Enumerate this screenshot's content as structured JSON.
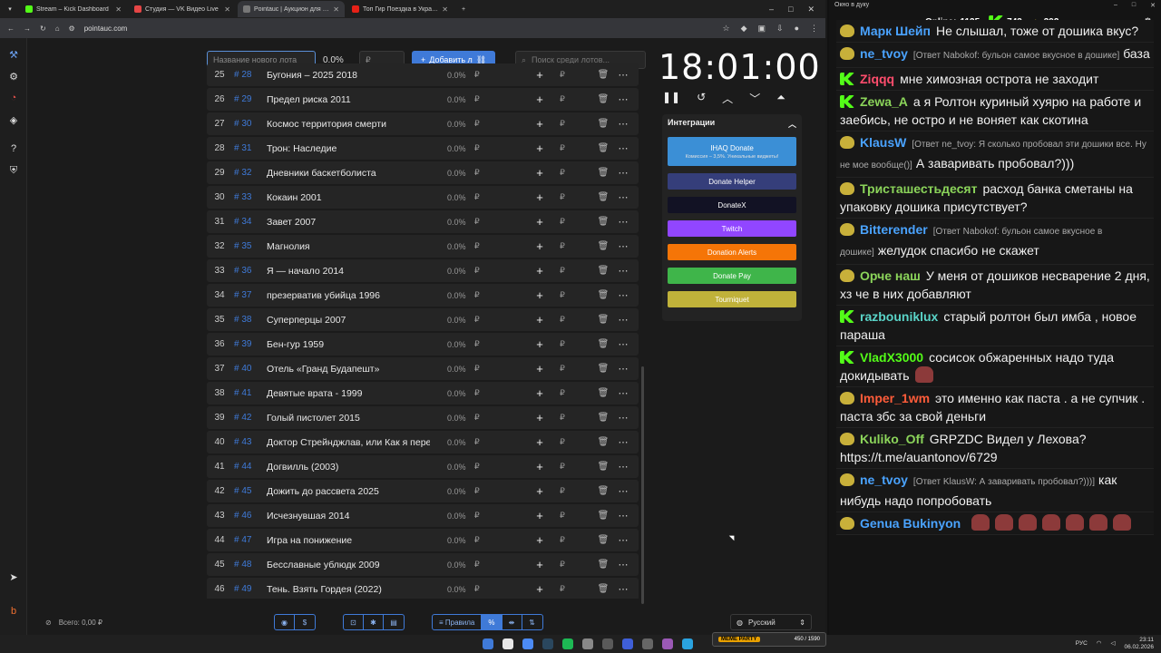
{
  "browser": {
    "tabs": [
      {
        "label": "Stream – Kick Dashboard",
        "color": "#53fc18",
        "active": false
      },
      {
        "label": "Студия — VK Видео Live",
        "color": "#e64646",
        "active": false
      },
      {
        "label": "Pointauc | Аукцион для стримо...",
        "color": "#777777",
        "active": true
      },
      {
        "label": "Топ Гир Поездка в Украину (...",
        "color": "#e62117",
        "active": false
      }
    ],
    "url": "pointauc.com"
  },
  "controls": {
    "new_lot_placeholder": "Название нового лота",
    "percent": "0.0%",
    "amount_placeholder": "₽",
    "add_label": "Добавить л",
    "search_placeholder": "Поиск среди лотов..."
  },
  "lots": [
    {
      "n": "25",
      "id": "# 28",
      "name": "Бугония – 2025 2018",
      "pct": "0.0%"
    },
    {
      "n": "26",
      "id": "# 29",
      "name": "Предел риска 2011",
      "pct": "0.0%"
    },
    {
      "n": "27",
      "id": "# 30",
      "name": "Космос территория смерти",
      "pct": "0.0%"
    },
    {
      "n": "28",
      "id": "# 31",
      "name": "Трон: Наследие",
      "pct": "0.0%"
    },
    {
      "n": "29",
      "id": "# 32",
      "name": "Дневники баскетболиста",
      "pct": "0.0%"
    },
    {
      "n": "30",
      "id": "# 33",
      "name": "Кокаин 2001",
      "pct": "0.0%"
    },
    {
      "n": "31",
      "id": "# 34",
      "name": "Завет 2007",
      "pct": "0.0%"
    },
    {
      "n": "32",
      "id": "# 35",
      "name": "Магнолия",
      "pct": "0.0%"
    },
    {
      "n": "33",
      "id": "# 36",
      "name": "Я — начало 2014",
      "pct": "0.0%"
    },
    {
      "n": "34",
      "id": "# 37",
      "name": "презерватив убийца 1996",
      "pct": "0.0%"
    },
    {
      "n": "35",
      "id": "# 38",
      "name": "Суперперцы 2007",
      "pct": "0.0%"
    },
    {
      "n": "36",
      "id": "# 39",
      "name": "Бен-гур 1959",
      "pct": "0.0%"
    },
    {
      "n": "37",
      "id": "# 40",
      "name": "Отель «Гранд Будапешт»",
      "pct": "0.0%"
    },
    {
      "n": "38",
      "id": "# 41",
      "name": "Девятые врата - 1999",
      "pct": "0.0%"
    },
    {
      "n": "39",
      "id": "# 42",
      "name": "Голый пистолет 2015",
      "pct": "0.0%"
    },
    {
      "n": "40",
      "id": "# 43",
      "name": "Доктор Стрейнджлав, или Как я перес",
      "pct": "0.0%"
    },
    {
      "n": "41",
      "id": "# 44",
      "name": "Догвилль (2003)",
      "pct": "0.0%"
    },
    {
      "n": "42",
      "id": "# 45",
      "name": "Дожить до рассвета 2025",
      "pct": "0.0%"
    },
    {
      "n": "43",
      "id": "# 46",
      "name": "Исчезнувшая 2014",
      "pct": "0.0%"
    },
    {
      "n": "44",
      "id": "# 47",
      "name": "Игра на понижение",
      "pct": "0.0%"
    },
    {
      "n": "45",
      "id": "# 48",
      "name": "Бесславные ублюдк 2009",
      "pct": "0.0%"
    },
    {
      "n": "46",
      "id": "# 49",
      "name": "Тень. Взять Гордея (2022)",
      "pct": "0.0%"
    }
  ],
  "currency": "₽",
  "timer": "18:01:00",
  "integrations": {
    "title": "Интеграции",
    "items": [
      {
        "label": "IHAQ Donate",
        "sub": "Комиссия – 3,5%. Уникальные виджеты!",
        "color": "#3b8fd6"
      },
      {
        "label": "Donate Helper",
        "color": "#353e7a"
      },
      {
        "label": "DonateX",
        "color": "#121224"
      },
      {
        "label": "Twitch",
        "color": "#9146ff"
      },
      {
        "label": "Donation Alerts",
        "color": "#f57507"
      },
      {
        "label": "Donate Pay",
        "color": "#3fb54a"
      },
      {
        "label": "Tourniquet",
        "color": "#c0b23a"
      }
    ]
  },
  "footer": {
    "total": "Всего: 0,00 ₽",
    "rules": "Правила",
    "language": "Русский"
  },
  "chat": {
    "window_title": "Окно в дуку",
    "online_label": "Online:",
    "online": "1135",
    "kick": "743",
    "vk": "392",
    "messages": [
      {
        "badge": "s",
        "user": "Марк Шейп",
        "color": "#4aa3ff",
        "reply": "",
        "text": "Не слышал, тоже от дошика вкус?",
        "emote": false
      },
      {
        "badge": "s",
        "user": "ne_tvoy",
        "color": "#4aa3ff",
        "reply": "[Ответ Nabokof: бульон самое вкусное в дошике]",
        "text": "база",
        "emote": false
      },
      {
        "badge": "k",
        "user": "Ziqqq",
        "color": "#ff4d6d",
        "reply": "",
        "text": "мне химозная острота не заходит",
        "emote": false
      },
      {
        "badge": "k",
        "user": "Zewa_A",
        "color": "#8bd45a",
        "reply": "",
        "text": "а я Ролтон куриный хуярю на работе и заебись, не остро и не воняет как скотина",
        "emote": false
      },
      {
        "badge": "s",
        "user": "KlausW",
        "color": "#4aa3ff",
        "reply": "[Ответ ne_tvoy: Я сколько пробовал эти дошики все. Ну не мое вообще()]",
        "text": "А заваривать пробовал?)))",
        "emote": false
      },
      {
        "badge": "s",
        "user": "Тристашестьдесят",
        "color": "#8bd45a",
        "reply": "",
        "text": "расход банка сметаны на упаковку дошика присутствует?",
        "emote": false
      },
      {
        "badge": "s",
        "user": "Bitterender",
        "color": "#4aa3ff",
        "reply": "[Ответ Nabokof: бульон самое вкусное в дошике]",
        "text": "желудок спасибо не скажет",
        "emote": false
      },
      {
        "badge": "s",
        "user": "Орче наш",
        "color": "#8bd45a",
        "reply": "",
        "text": "У меня от дошиков несварение 2 дня, хз че в них добавляют",
        "emote": false
      },
      {
        "badge": "k",
        "user": "razbouniklux",
        "color": "#5ad4c8",
        "reply": "",
        "text": "старый ролтон был имба , новое параша",
        "emote": false
      },
      {
        "badge": "k",
        "user": "VladX3000",
        "color": "#53fc18",
        "reply": "",
        "text": "сосисок обжаренных надо туда докидывать",
        "emote": true
      },
      {
        "badge": "s",
        "user": "Imper_1wm",
        "color": "#ff5c3a",
        "reply": "",
        "text": "это именно как паста . а не супчик . паста збс за свой деньги",
        "emote": false
      },
      {
        "badge": "s",
        "user": "Kuliko_Off",
        "color": "#8bd45a",
        "reply": "",
        "text": "GRPZDC Видел у Лехова? https://t.me/auantonov/6729",
        "emote": false
      },
      {
        "badge": "s",
        "user": "ne_tvoy",
        "color": "#4aa3ff",
        "reply": "[Ответ KlausW: А заваривать пробовал?)))]",
        "text": "как нибудь надо попробовать",
        "emote": false
      },
      {
        "badge": "s",
        "user": "Genua Bukinyon",
        "color": "#4aa3ff",
        "reply": "",
        "text": "",
        "emote": true
      }
    ]
  },
  "taskbar": {
    "meme_label": "MEME PARTY",
    "meme_count": "450 / 1590",
    "lang": "РУС",
    "time": "23:11",
    "date": "06.02.2026"
  }
}
